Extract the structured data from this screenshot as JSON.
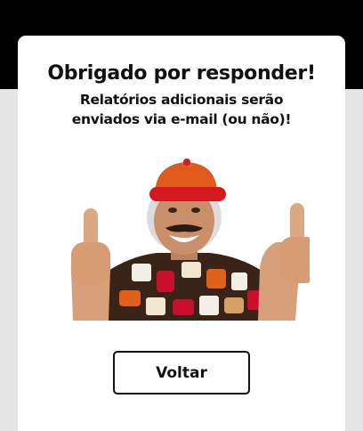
{
  "modal": {
    "title": "Obrigado por responder!",
    "subtitle": "Relatórios adicionais serão enviados via e-mail (ou não)!",
    "image_icon": "thumbs-up-man-image",
    "button_label": "Voltar"
  },
  "colors": {
    "top_band": "#000000",
    "background": "#e5e5e5",
    "modal": "#ffffff",
    "text": "#111111"
  }
}
